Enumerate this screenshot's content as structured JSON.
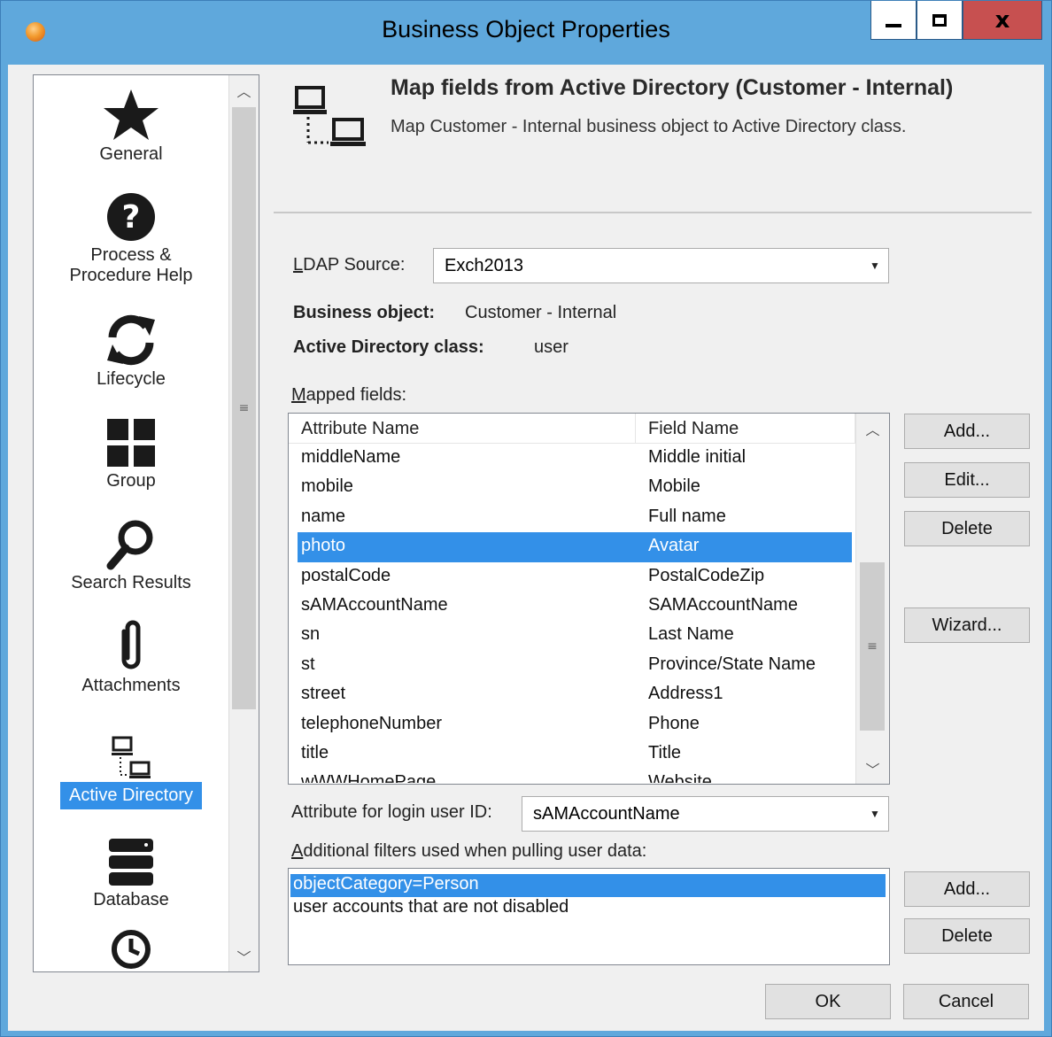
{
  "window": {
    "title": "Business Object Properties",
    "minimize_label": "minimize",
    "maximize_label": "maximize",
    "close_glyph": "x"
  },
  "nav": {
    "items": [
      {
        "label": "General",
        "icon": "star-icon"
      },
      {
        "label": "Process & Procedure Help",
        "label_line1": "Process &",
        "label_line2": "Procedure Help",
        "icon": "question-icon"
      },
      {
        "label": "Lifecycle",
        "icon": "refresh-icon"
      },
      {
        "label": "Group",
        "icon": "grid-icon"
      },
      {
        "label": "Search Results",
        "icon": "magnifier-icon"
      },
      {
        "label": "Attachments",
        "icon": "paperclip-icon"
      },
      {
        "label": "Active Directory",
        "icon": "network-computers-icon",
        "selected": true
      },
      {
        "label": "Database",
        "icon": "database-icon"
      },
      {
        "label": "",
        "icon": "clock-icon"
      }
    ]
  },
  "header": {
    "title": "Map fields from Active Directory  (Customer - Internal)",
    "subtitle": "Map Customer - Internal business object to Active Directory class."
  },
  "ldap_source": {
    "label": "LDAP Source:",
    "value": "Exch2013"
  },
  "business_object": {
    "label": "Business object:",
    "value": "Customer - Internal"
  },
  "ad_class": {
    "label": "Active Directory class:",
    "value": "user"
  },
  "mapped_fields": {
    "label": "Mapped fields:",
    "columns": [
      "Attribute Name",
      "Field Name"
    ],
    "rows": [
      {
        "attribute": "middleName",
        "field": "Middle initial"
      },
      {
        "attribute": "mobile",
        "field": "Mobile"
      },
      {
        "attribute": "name",
        "field": "Full name"
      },
      {
        "attribute": "photo",
        "field": "Avatar",
        "selected": true
      },
      {
        "attribute": "postalCode",
        "field": "PostalCodeZip"
      },
      {
        "attribute": "sAMAccountName",
        "field": "SAMAccountName"
      },
      {
        "attribute": "sn",
        "field": "Last Name"
      },
      {
        "attribute": "st",
        "field": "Province/State Name"
      },
      {
        "attribute": "street",
        "field": "Address1"
      },
      {
        "attribute": "telephoneNumber",
        "field": "Phone"
      },
      {
        "attribute": "title",
        "field": "Title"
      },
      {
        "attribute": "wWWHomePage",
        "field": "Website"
      }
    ],
    "buttons": {
      "add": "Add...",
      "edit": "Edit...",
      "delete": "Delete",
      "wizard": "Wizard..."
    }
  },
  "login_attribute": {
    "label": "Attribute for login user ID:",
    "value": "sAMAccountName"
  },
  "filters": {
    "label": "Additional filters used when pulling user data:",
    "items": [
      {
        "text": "objectCategory=Person",
        "selected": true
      },
      {
        "text": "user accounts that are not disabled"
      }
    ],
    "buttons": {
      "add": "Add...",
      "delete": "Delete"
    }
  },
  "footer": {
    "ok": "OK",
    "cancel": "Cancel"
  },
  "colors": {
    "selection": "#3390e8",
    "titlebar": "#5fa8dc",
    "close_button": "#c75050"
  }
}
